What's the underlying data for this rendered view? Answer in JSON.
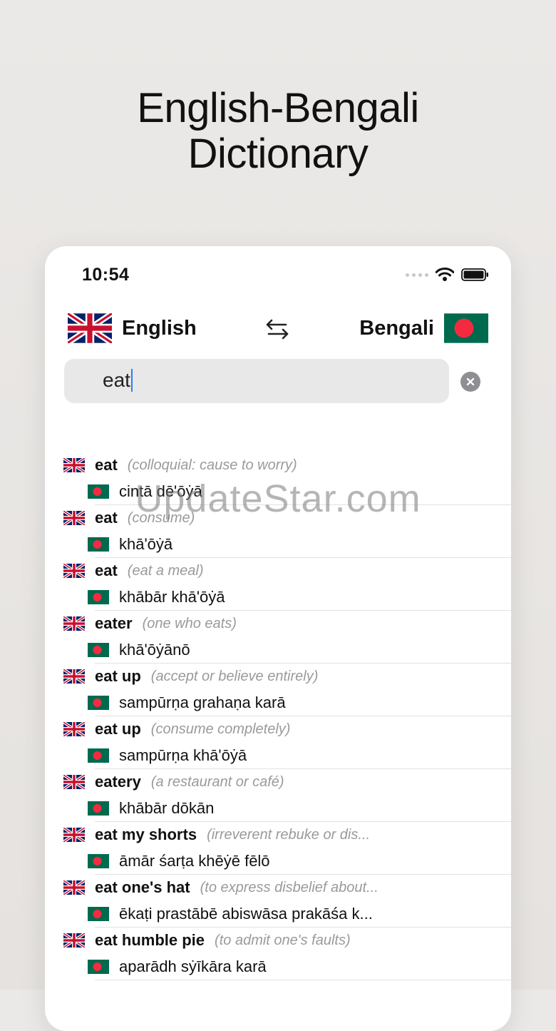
{
  "promo": {
    "title_line1": "English-Bengali",
    "title_line2": "Dictionary"
  },
  "status_bar": {
    "time": "10:54"
  },
  "language_bar": {
    "source_label": "English",
    "target_label": "Bengali",
    "swap_icon": "swap-arrows-icon"
  },
  "search": {
    "value": "eat"
  },
  "results": [
    {
      "word": "eat",
      "note": "(colloquial: cause to worry)",
      "translation": "cintā dē'ōẏā"
    },
    {
      "word": "eat",
      "note": "(consume)",
      "translation": "khā'ōẏā"
    },
    {
      "word": "eat",
      "note": "(eat a meal)",
      "translation": "khābār khā'ōẏā"
    },
    {
      "word": "eater",
      "note": "(one who eats)",
      "translation": "khā'ōẏānō"
    },
    {
      "word": "eat up",
      "note": "(accept or believe entirely)",
      "translation": "sampūrṇa grahaṇa karā"
    },
    {
      "word": "eat up",
      "note": "(consume completely)",
      "translation": "sampūrṇa khā'ōẏā"
    },
    {
      "word": "eatery",
      "note": "(a restaurant or café)",
      "translation": "khābār dōkān"
    },
    {
      "word": "eat my shorts",
      "note": "(irreverent rebuke or dis...",
      "translation": "āmār śarṭa khēẏē fēlō"
    },
    {
      "word": "eat one's hat",
      "note": "(to express disbelief about...",
      "translation": "ēkaṭi prastābē abiswāsa prakāśa k..."
    },
    {
      "word": "eat humble pie",
      "note": "(to admit one's faults)",
      "translation": "aparādh sẏīkāra karā"
    }
  ],
  "watermark": "UpdateStar.com",
  "colors": {
    "bangladesh_green": "#006a4e",
    "bangladesh_red": "#f42a41",
    "uk_blue": "#012169",
    "uk_red": "#c8102e",
    "caret_blue": "#2f7cf6"
  }
}
